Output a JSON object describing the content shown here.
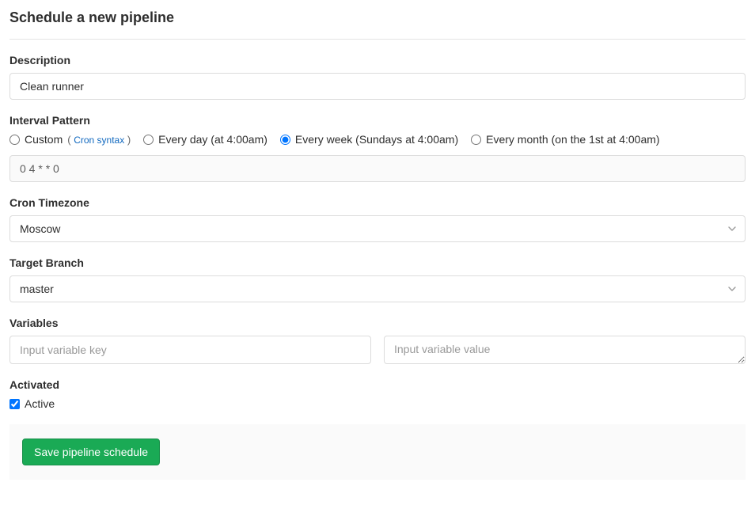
{
  "page": {
    "title": "Schedule a new pipeline"
  },
  "description": {
    "label": "Description",
    "value": "Clean runner"
  },
  "interval": {
    "label": "Interval Pattern",
    "options": {
      "custom": {
        "label": "Custom",
        "link_text": "Cron syntax",
        "checked": false
      },
      "daily": {
        "label": "Every day (at 4:00am)",
        "checked": false
      },
      "weekly": {
        "label": "Every week (Sundays at 4:00am)",
        "checked": true
      },
      "monthly": {
        "label": "Every month (on the 1st at 4:00am)",
        "checked": false
      }
    },
    "cron_value": "0 4 * * 0"
  },
  "timezone": {
    "label": "Cron Timezone",
    "value": "Moscow"
  },
  "branch": {
    "label": "Target Branch",
    "value": "master"
  },
  "variables": {
    "label": "Variables",
    "key_placeholder": "Input variable key",
    "value_placeholder": "Input variable value"
  },
  "activated": {
    "label": "Activated",
    "checkbox_label": "Active",
    "checked": true
  },
  "footer": {
    "save_label": "Save pipeline schedule"
  }
}
